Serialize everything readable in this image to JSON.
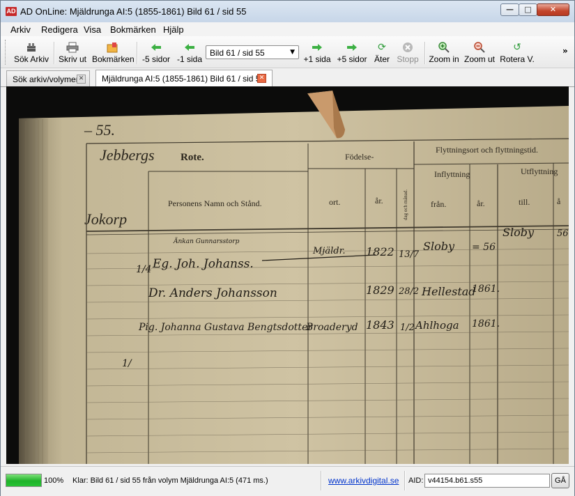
{
  "window": {
    "title": "AD OnLine: Mjäldrunga AI:5 (1855-1861)  Bild 61 / sid 55",
    "app_icon_text": "AD",
    "controls": {
      "minimize": "—",
      "maximize": "□",
      "close": "✕"
    }
  },
  "menu": [
    "Arkiv",
    "Redigera",
    "Visa",
    "Bokmärken",
    "Hjälp"
  ],
  "toolbar": {
    "buttons": [
      {
        "label": "Sök Arkiv",
        "icon": "archive-search-icon"
      },
      {
        "label": "Skriv ut",
        "icon": "printer-icon"
      },
      {
        "label": "Bokmärken",
        "icon": "bookmarks-icon"
      },
      {
        "label": "-5 sidor",
        "icon": "arrow-left-icon"
      },
      {
        "label": "-1 sida",
        "icon": "arrow-left-icon"
      },
      {
        "label": "+1 sida",
        "icon": "arrow-right-icon"
      },
      {
        "label": "+5 sidor",
        "icon": "arrow-right-icon"
      },
      {
        "label": "Äter",
        "icon": "refresh-icon"
      },
      {
        "label": "Stopp",
        "icon": "stop-icon",
        "disabled": true
      },
      {
        "label": "Zoom in",
        "icon": "zoom-in-icon"
      },
      {
        "label": "Zoom ut",
        "icon": "zoom-out-icon"
      },
      {
        "label": "Rotera V.",
        "icon": "rotate-left-icon"
      }
    ],
    "page_select": "Bild 61 / sid 55",
    "overflow": "»"
  },
  "tabs": [
    {
      "label": "Sök arkiv/volymer",
      "active": false
    },
    {
      "label": "Mjäldrunga AI:5 (1855-1861)  Bild 61 / sid 55",
      "active": true
    }
  ],
  "document": {
    "page_heading": "– 55.",
    "rote": "Rote.",
    "rote_hand": "Jebbergs",
    "left_column": "Jokorp",
    "col_fodelse": "Födelse-",
    "col_flyttning": "Flyttningsort och flyttningstid.",
    "col_inflyttning": "Inflyttning",
    "col_utflyttning": "Utflyttning",
    "col_namn": "Personens Namn och Stånd.",
    "col_ort": "ort.",
    "col_ar": "år.",
    "col_dag": "dag och månad.",
    "col_fran": "från.",
    "col_ar2": "år.",
    "col_till": "till.",
    "col_ar3": "å",
    "rows": [
      {
        "mark": "1/4",
        "name": "Eg. Joh. Johanss.",
        "above": "Änkan   Gunnarsstorp",
        "ort": "Mjäldr.",
        "year": "1822",
        "date": "13/7",
        "from": "Sloby",
        "fromyear": "= 56",
        "to": "Sloby",
        "toyear": "56"
      },
      {
        "mark": "",
        "name": "Dr. Anders Johansson",
        "above": "",
        "ort": "",
        "year": "1829",
        "date": "28/2",
        "from": "Hellestad",
        "fromyear": "1861.",
        "to": "",
        "toyear": ""
      },
      {
        "mark": "",
        "name": "Pig. Johanna Gustava Bengtsdotter",
        "above": "",
        "ort": "Broaderyd",
        "year": "1843",
        "date": "1/2",
        "from": "Ahlhoga",
        "fromyear": "1861.",
        "to": "",
        "toyear": ""
      }
    ],
    "bottom_mark": "1/"
  },
  "status": {
    "progress": 1.0,
    "percent": "100%",
    "message": "Klar: Bild 61 / sid 55 från volym Mjäldrunga AI:5 (471 ms.)",
    "link": "www.arkivdigital.se",
    "aid_label": "AID:",
    "aid_value": "v44154.b61.s55",
    "go_label": "GÅ"
  },
  "colors": {
    "paper": "#c9bd9d",
    "ink": "#1a1712",
    "accent_green": "#1fb32a",
    "close_red": "#c3462c"
  }
}
